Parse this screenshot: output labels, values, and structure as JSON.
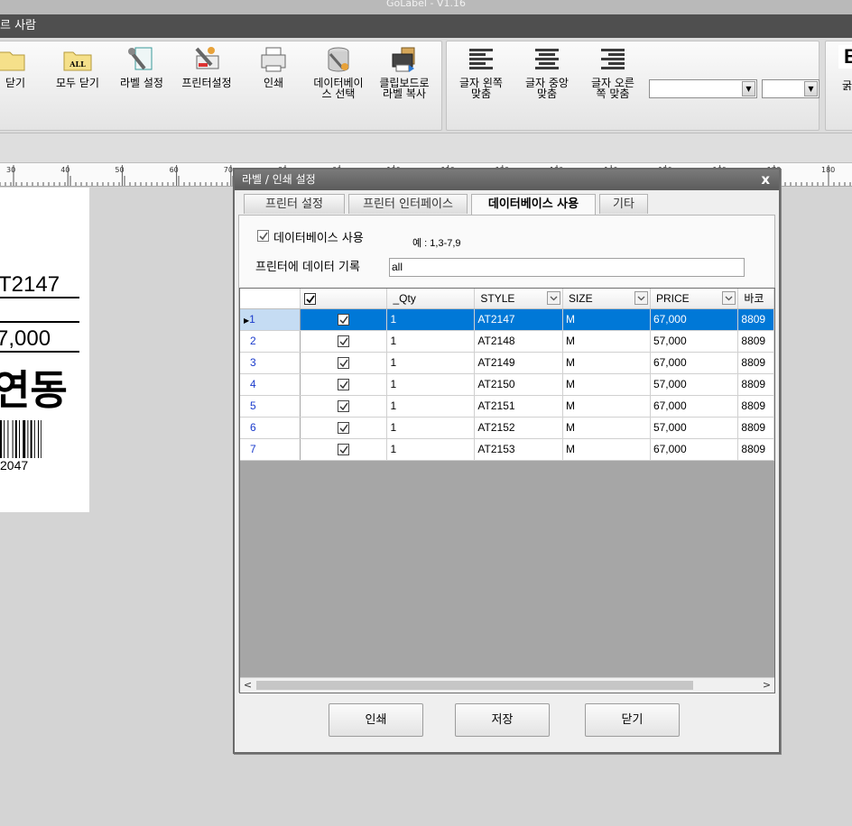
{
  "app": {
    "title": "GoLabel - V1.16"
  },
  "document": {
    "title": "르 사람"
  },
  "ribbon": {
    "buttons": [
      {
        "label": "닫기",
        "icon": "folder-icon"
      },
      {
        "label": "모두 닫기",
        "icon": "folder-all-icon",
        "badge": "ALL"
      },
      {
        "label": "라벨 설정",
        "icon": "label-settings-icon"
      },
      {
        "label": "프린터설정",
        "icon": "printer-settings-icon"
      },
      {
        "label": "인쇄",
        "icon": "printer-icon"
      },
      {
        "label": "데이터베이\n스 선택",
        "icon": "database-select-icon"
      },
      {
        "label": "클립보드로\n라벨 복사",
        "icon": "clipboard-copy-icon"
      },
      {
        "label": "글자 왼쪽\n맞춤",
        "icon": "align-left-icon"
      },
      {
        "label": "글자 중앙\n맞춤",
        "icon": "align-center-icon"
      },
      {
        "label": "글자 오른\n쪽 맞춤",
        "icon": "align-right-icon"
      }
    ],
    "font_combo_value": "",
    "size_combo_value": "",
    "cut_label": "B",
    "cut_sub": "굵"
  },
  "ruler": {
    "ticks": [
      "30",
      "40",
      "50",
      "60",
      "70",
      "80",
      "90",
      "100",
      "110",
      "120",
      "130",
      "140",
      "150",
      "160",
      "170",
      "180"
    ]
  },
  "label_canvas": {
    "line1": "T2147",
    "line2": "7,000",
    "line3": "연동",
    "barcode_text": "2047"
  },
  "dialog": {
    "title": "라벨 / 인쇄 설정",
    "close": "x",
    "tabs": [
      "프린터 설정",
      "프린터 인터페이스",
      "데이터베이스 사용",
      "기타"
    ],
    "active_tab": 2,
    "use_db_label": "데이터베이스 사용",
    "use_db_checked": true,
    "example_text": "예 : 1,3-7,9",
    "record_label": "프린터에 데이터 기록",
    "record_value": "all",
    "grid": {
      "columns": [
        "",
        "_Qty",
        "STYLE",
        "SIZE",
        "PRICE",
        "바코"
      ],
      "rows": [
        {
          "num": "1",
          "checked": true,
          "qty": "1",
          "style": "AT2147",
          "size": "M",
          "price": "67,000",
          "barcode": "8809"
        },
        {
          "num": "2",
          "checked": true,
          "qty": "1",
          "style": "AT2148",
          "size": "M",
          "price": "57,000",
          "barcode": "8809"
        },
        {
          "num": "3",
          "checked": true,
          "qty": "1",
          "style": "AT2149",
          "size": "M",
          "price": "67,000",
          "barcode": "8809"
        },
        {
          "num": "4",
          "checked": true,
          "qty": "1",
          "style": "AT2150",
          "size": "M",
          "price": "57,000",
          "barcode": "8809"
        },
        {
          "num": "5",
          "checked": true,
          "qty": "1",
          "style": "AT2151",
          "size": "M",
          "price": "67,000",
          "barcode": "8809"
        },
        {
          "num": "6",
          "checked": true,
          "qty": "1",
          "style": "AT2152",
          "size": "M",
          "price": "57,000",
          "barcode": "8809"
        },
        {
          "num": "7",
          "checked": true,
          "qty": "1",
          "style": "AT2153",
          "size": "M",
          "price": "67,000",
          "barcode": "8809"
        }
      ],
      "selected_row": 0
    },
    "buttons": {
      "print": "인쇄",
      "save": "저장",
      "close": "닫기"
    }
  },
  "colors": {
    "selection": "#0078d7",
    "titlebar": "#4f4f4f",
    "row_number": "#1a3bcc"
  }
}
